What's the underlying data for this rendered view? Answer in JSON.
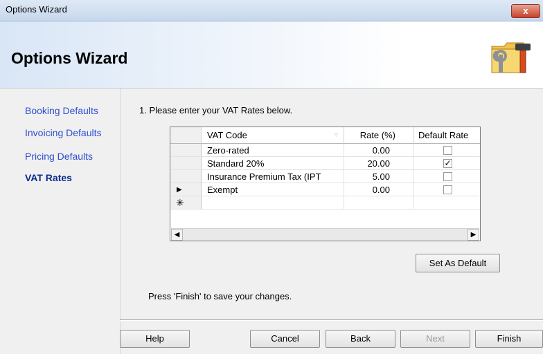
{
  "window": {
    "title": "Options Wizard",
    "close_label": "x"
  },
  "banner": {
    "title": "Options Wizard",
    "icon": "folder-tools-icon"
  },
  "sidebar": {
    "items": [
      {
        "label": "Booking Defaults",
        "active": false
      },
      {
        "label": "Invoicing Defaults",
        "active": false
      },
      {
        "label": "Pricing Defaults",
        "active": false
      },
      {
        "label": "VAT Rates",
        "active": true
      }
    ]
  },
  "main": {
    "instruction": "1. Please enter your VAT Rates below.",
    "grid": {
      "columns": [
        "VAT Code",
        "Rate (%)",
        "Default Rate"
      ],
      "rows": [
        {
          "marker": "",
          "code": "Zero-rated",
          "rate": "0.00",
          "default": false
        },
        {
          "marker": "",
          "code": "Standard 20%",
          "rate": "20.00",
          "default": true
        },
        {
          "marker": "",
          "code": "Insurance Premium Tax (IPT",
          "rate": "5.00",
          "default": false
        },
        {
          "marker": "▶",
          "code": "Exempt",
          "rate": "0.00",
          "default": false
        },
        {
          "marker": "✳",
          "code": "",
          "rate": "",
          "default": null
        }
      ]
    },
    "set_default_label": "Set As Default",
    "finish_hint": "Press 'Finish' to save your changes."
  },
  "footer": {
    "help_label": "Help",
    "cancel_label": "Cancel",
    "back_label": "Back",
    "next_label": "Next",
    "finish_label": "Finish"
  }
}
